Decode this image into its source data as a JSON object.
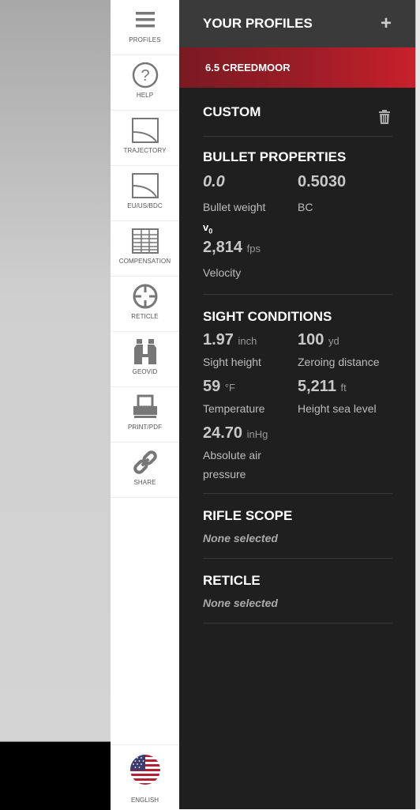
{
  "nav": {
    "items": [
      {
        "label": "PROFILES",
        "icon": "hamburger-icon"
      },
      {
        "label": "HELP",
        "icon": "question-icon"
      },
      {
        "label": "TRAJECTORY",
        "icon": "trajectory-icon"
      },
      {
        "label": "EU/US/BDC",
        "icon": "trajectory-curve-icon"
      },
      {
        "label": "COMPENSATION",
        "icon": "table-icon"
      },
      {
        "label": "RETICLE",
        "icon": "crosshair-icon"
      },
      {
        "label": "GEOVID",
        "icon": "binoculars-icon"
      },
      {
        "label": "PRINT/PDF",
        "icon": "printer-icon"
      },
      {
        "label": "SHARE",
        "icon": "link-icon"
      }
    ],
    "language": {
      "label": "ENGLISH",
      "icon": "us-flag-icon"
    }
  },
  "panel": {
    "title": "YOUR PROFILES",
    "add_icon": "+",
    "active_profile": "6.5 CREEDMOOR",
    "custom_title": "CUSTOM",
    "bullet": {
      "title": "BULLET PROPERTIES",
      "weight_value": "0.0",
      "weight_label": "Bullet weight",
      "bc_value": "0.5030",
      "bc_label": "BC",
      "v0_symbol": "v",
      "v0_sub": "0",
      "velocity_value": "2,814",
      "velocity_unit": "fps",
      "velocity_label": "Velocity"
    },
    "sight": {
      "title": "SIGHT CONDITIONS",
      "sight_height_value": "1.97",
      "sight_height_unit": "inch",
      "sight_height_label": "Sight height",
      "zero_value": "100",
      "zero_unit": "yd",
      "zero_label": "Zeroing distance",
      "temp_value": "59",
      "temp_unit": "°F",
      "temp_label": "Temperature",
      "alt_value": "5,211",
      "alt_unit": "ft",
      "alt_label": "Height sea level",
      "pressure_value": "24.70",
      "pressure_unit": "inHg",
      "pressure_label": "Absolute air pressure"
    },
    "scope": {
      "title": "RIFLE SCOPE",
      "value": "None selected"
    },
    "reticle": {
      "title": "RETICLE",
      "value": "None selected"
    }
  }
}
